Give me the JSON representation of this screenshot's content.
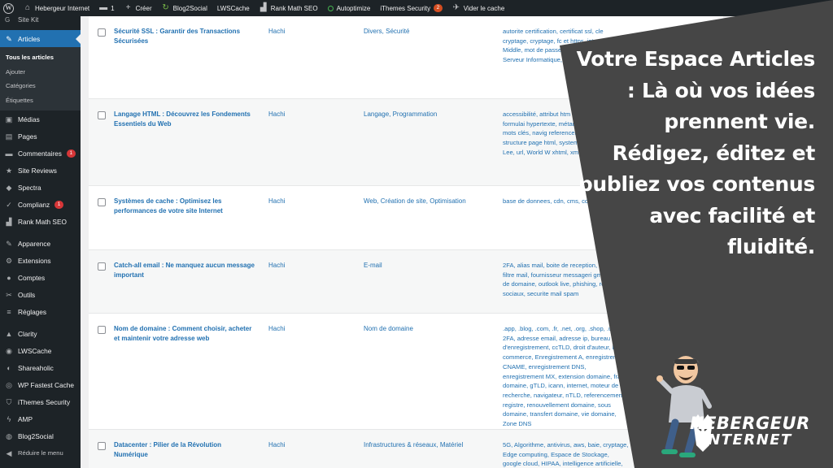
{
  "adminbar": {
    "wp_icon": "wordpress-icon",
    "site_name": "Hebergeur Internet",
    "comments_count": "1",
    "new_label": "Créer",
    "blog2social": "Blog2Social",
    "lwscache": "LWSCache",
    "rankmath": "Rank Math SEO",
    "autoptimize": "Autoptimize",
    "ithemes": "iThemes Security",
    "ithemes_badge": "2",
    "clear_cache": "Vider le cache"
  },
  "sidebar": {
    "partial_top": "Site Kit",
    "articles": "Articles",
    "submenu": [
      "Tous les articles",
      "Ajouter",
      "Catégories",
      "Étiquettes"
    ],
    "items": [
      {
        "label": "Médias",
        "icon": "media-icon"
      },
      {
        "label": "Pages",
        "icon": "pages-icon"
      },
      {
        "label": "Commentaires",
        "icon": "comments-icon",
        "badge": "1"
      },
      {
        "label": "Site Reviews",
        "icon": "star-icon"
      },
      {
        "label": "Spectra",
        "icon": "spectra-icon"
      },
      {
        "label": "Complianz",
        "icon": "complianz-icon",
        "badge": "1"
      },
      {
        "label": "Rank Math SEO",
        "icon": "rankmath-icon"
      }
    ],
    "items2": [
      {
        "label": "Apparence",
        "icon": "appearance-icon"
      },
      {
        "label": "Extensions",
        "icon": "plugins-icon"
      },
      {
        "label": "Comptes",
        "icon": "users-icon"
      },
      {
        "label": "Outils",
        "icon": "tools-icon"
      },
      {
        "label": "Réglages",
        "icon": "settings-icon"
      }
    ],
    "items3": [
      {
        "label": "Clarity",
        "icon": "clarity-icon"
      },
      {
        "label": "LWSCache",
        "icon": "lwscache-icon"
      },
      {
        "label": "Shareaholic",
        "icon": "shareaholic-icon"
      },
      {
        "label": "WP Fastest Cache",
        "icon": "fastest-cache-icon"
      },
      {
        "label": "iThemes Security",
        "icon": "shield-icon"
      },
      {
        "label": "AMP",
        "icon": "amp-icon"
      },
      {
        "label": "Blog2Social",
        "icon": "blog2social-icon"
      }
    ],
    "collapse": "Réduire le menu"
  },
  "posts": [
    {
      "title": "Sécurité SSL : Garantir des Transactions Sécurisées",
      "author": "Hachi",
      "categories": "Divers, Sécurité",
      "tags": "autorite certification, certificat ssl, cle cryptage, cryptage, fc et https, internet, Le Middle, mot de passe navigateur, protocole Serveur Informatique, url"
    },
    {
      "title": "Langage HTML : Découvrez les Fondements Essentiels du Web",
      "author": "Hachi",
      "categories": "Langage, Programmation",
      "tags": "accessibilité, attribut htm sémantique, css, formulai hypertexte, métadonnées, recherche, mots clés, navig referencement, Serveur Info structure page html, systeme Tim Berners-Lee, url, World W xhtml, xml"
    },
    {
      "title": "Systèmes de cache : Optimisez les performances de votre site Internet",
      "author": "Hachi",
      "categories": "Web, Création de site, Optimisation",
      "tags": "base de donnees, cdn, cms, con dynamique"
    },
    {
      "title": "Catch-all email : Ne manquez aucun message important",
      "author": "Hachi",
      "categories": "E-mail",
      "tags": "2FA, alias mail, boite de reception, do mail, filtre mail, fournisseur messageri gmail, nom de domaine, outlook live, phishing, reseaux sociaux, securite mail spam"
    },
    {
      "title": "Nom de domaine : Comment choisir, acheter et maintenir votre adresse web",
      "author": "Hachi",
      "categories": "Nom de domaine",
      "tags": ".app, .blog, .com, .fr, .net, .org, .shop, .uk, 2FA, adresse email, adresse ip, bureau d'enregistrement, ccTLD, droit d'auteur, E-commerce, Enregistrement A, enregistrement CNAME, enregistrement DNS, enregistrement MX, extension domaine, frais domaine, gTLD, icann, internet, moteur de recherche, navigateur, nTLD, referencement, registre, renouvellement domaine, sous domaine, transfert domaine, vie domaine, Zone DNS"
    },
    {
      "title": "Datacenter : Pilier de la Révolution Numérique",
      "author": "Hachi",
      "categories": "Infrastructures & réseaux, Matériel",
      "tags": "5G, Algorithme, antivirus, aws, baie, cryptage, Edge computing, Espace de Stockage, google cloud, HIPAA, intelligence artificielle, IoT, microsoft azure, moteur de",
      "extra": "—"
    }
  ],
  "overlay": {
    "headline": "Votre Espace Articles : Là où vos idées prennent vie. Rédigez, éditez et publiez vos contenus avec facilité et fluidité.",
    "brand_line1": "HEBERGEUR",
    "brand_line2": "INTERNET"
  },
  "colors": {
    "overlay_bg": "#464646",
    "accent": "#2271b1",
    "admin_bg": "#1d2327"
  }
}
